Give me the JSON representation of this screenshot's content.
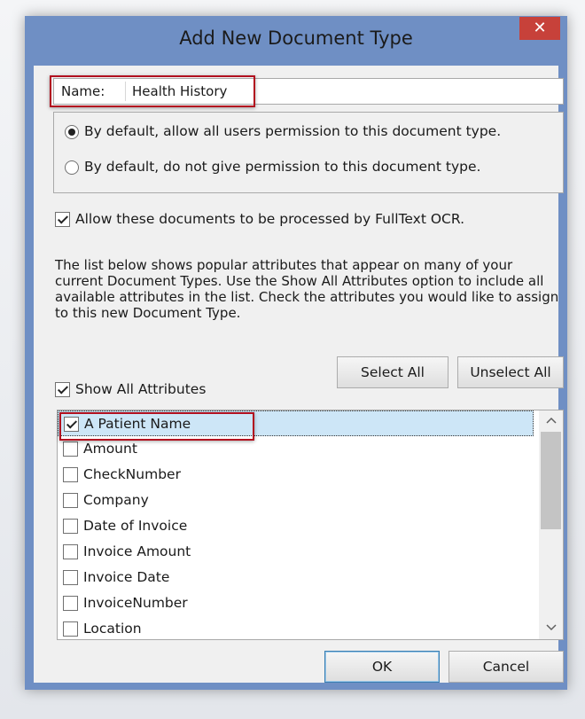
{
  "window": {
    "title": "Add New Document Type",
    "close_glyph": "✕"
  },
  "name_field": {
    "label": "Name:",
    "value": "Health History"
  },
  "permissions": {
    "options": [
      {
        "label": "By default, allow all users permission to this document type.",
        "selected": true
      },
      {
        "label": "By default, do not give permission to this document type.",
        "selected": false
      }
    ]
  },
  "ocr": {
    "label": "Allow these documents to be processed by FullText OCR.",
    "checked": true
  },
  "description": "The list below shows popular attributes that appear on many of your current Document Types.  Use the Show All Attributes option to include all available attributes in the list.  Check the attributes you would like to assign to this new Document Type.",
  "show_all": {
    "label": "Show All Attributes",
    "checked": true
  },
  "buttons": {
    "select_all": "Select All",
    "unselect_all": "Unselect All",
    "ok": "OK",
    "cancel": "Cancel"
  },
  "attributes": [
    {
      "label": "A Patient Name",
      "checked": true,
      "selected": true
    },
    {
      "label": "Amount",
      "checked": false
    },
    {
      "label": "CheckNumber",
      "checked": false
    },
    {
      "label": "Company",
      "checked": false
    },
    {
      "label": "Date of Invoice",
      "checked": false
    },
    {
      "label": "Invoice Amount",
      "checked": false
    },
    {
      "label": "Invoice Date",
      "checked": false
    },
    {
      "label": "InvoiceNumber",
      "checked": false
    },
    {
      "label": "Location",
      "checked": false
    }
  ],
  "icons": {
    "scroll_up": "chevron-up-icon",
    "scroll_down": "chevron-down-icon"
  },
  "colors": {
    "highlight": "#b2101f",
    "title_bar": "#6f8fc4",
    "close_button": "#c7413a",
    "selection": "#cde6f7"
  }
}
